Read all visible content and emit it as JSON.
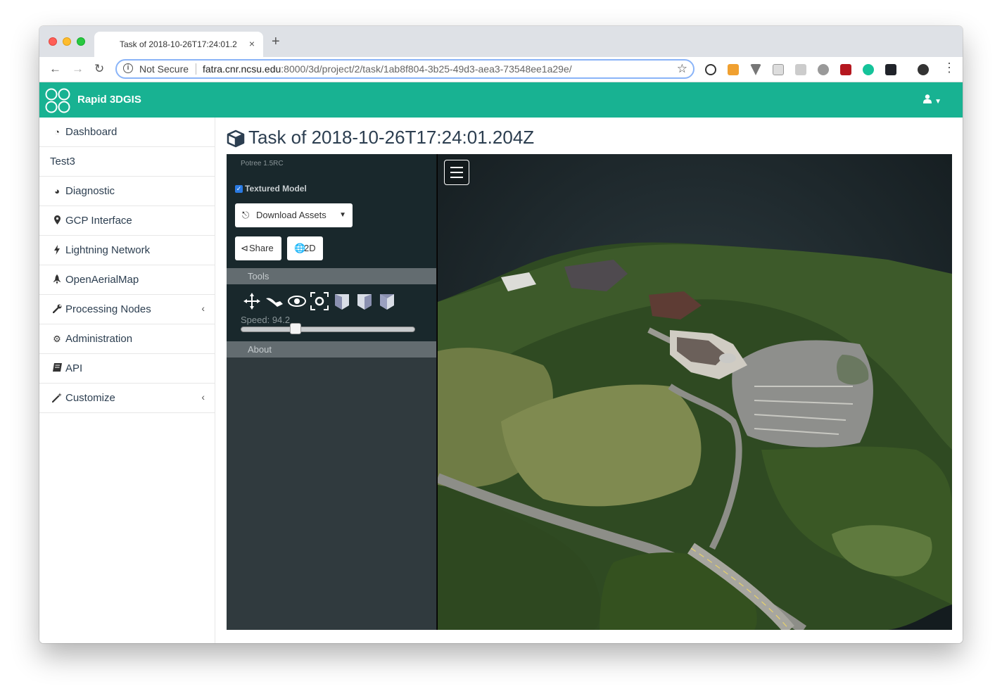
{
  "browser": {
    "tab_title": "Task of 2018-10-26T17:24:01.2",
    "tab_close": "×",
    "new_tab": "+",
    "security_label": "Not Secure",
    "url_host": "fatra.cnr.ncsu.edu",
    "url_path": ":8000/3d/project/2/task/1ab8f804-3b25-49d3-aea3-73548ee1a29e/"
  },
  "app": {
    "brand": "Rapid 3DGIS",
    "brand_color": "#18b292"
  },
  "sidebar": {
    "items": [
      {
        "label": "Dashboard",
        "icon": "dashboard-icon"
      },
      {
        "label": "Test3",
        "icon": ""
      },
      {
        "label": "Diagnostic",
        "icon": "pie-chart-icon"
      },
      {
        "label": "GCP Interface",
        "icon": "map-marker-icon"
      },
      {
        "label": "Lightning Network",
        "icon": "bolt-icon"
      },
      {
        "label": "OpenAerialMap",
        "icon": "rocket-icon"
      },
      {
        "label": "Processing Nodes",
        "icon": "wrench-icon",
        "expandable": true
      },
      {
        "label": "Administration",
        "icon": "cogs-icon"
      },
      {
        "label": "API",
        "icon": "book-icon"
      },
      {
        "label": "Customize",
        "icon": "magic-icon",
        "expandable": true
      }
    ]
  },
  "main": {
    "title": "Task of 2018-10-26T17:24:01.204Z"
  },
  "potree": {
    "version": "Potree 1.5RC",
    "textured_model_label": "Textured Model",
    "textured_model_checked": true,
    "download_label": "Download Assets",
    "share_label": "Share",
    "twod_label": "2D",
    "tools_heading": "Tools",
    "speed_label": "Speed: 94.2",
    "speed_value": 94.2,
    "speed_fraction": 0.3,
    "about_heading": "About"
  }
}
